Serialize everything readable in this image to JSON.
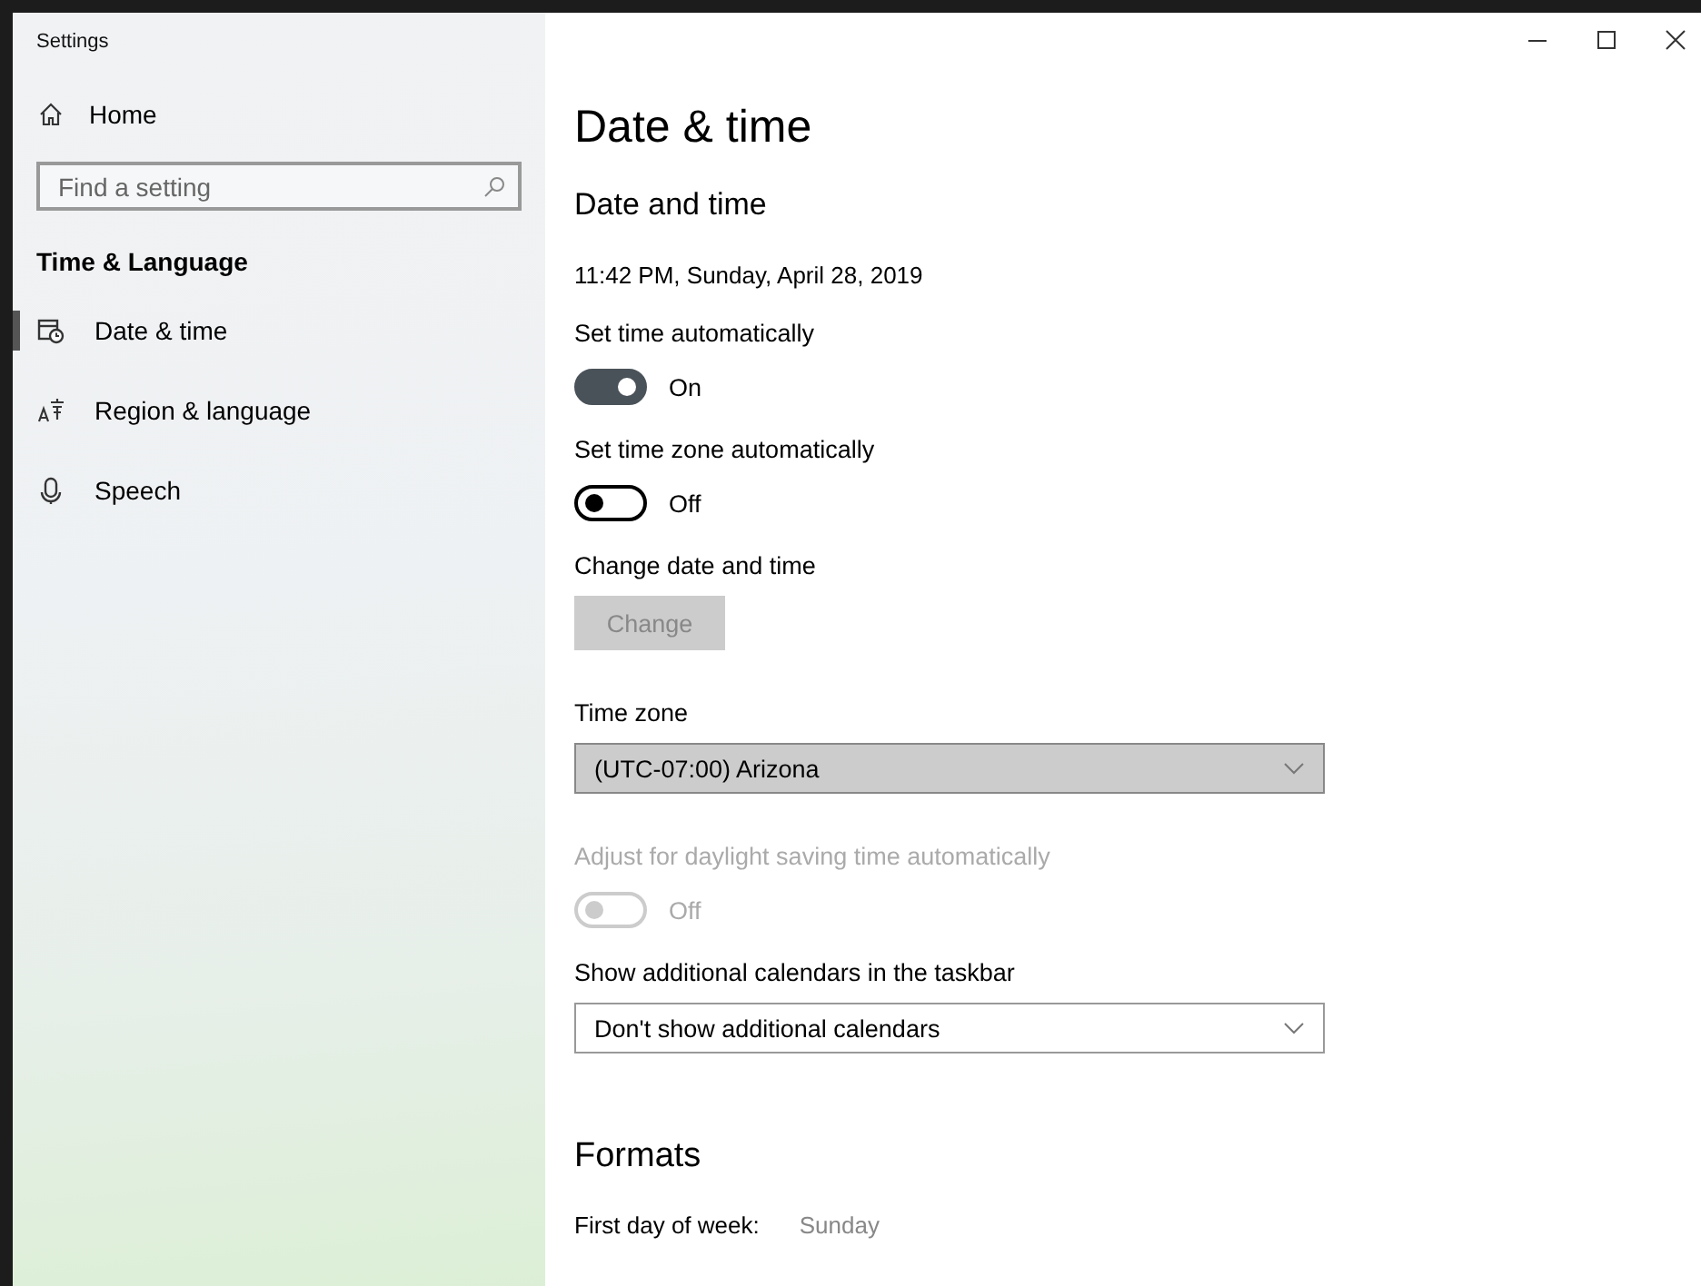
{
  "window": {
    "title": "Settings"
  },
  "sidebar": {
    "home": "Home",
    "search": {
      "placeholder": "Find a setting"
    },
    "section": "Time & Language",
    "items": [
      {
        "label": "Date & time",
        "selected": true
      },
      {
        "label": "Region & language",
        "selected": false
      },
      {
        "label": "Speech",
        "selected": false
      }
    ]
  },
  "page": {
    "title": "Date & time",
    "heading": "Date and time",
    "current": "11:42 PM, Sunday, April 28, 2019",
    "settings": [
      {
        "kind": "toggle",
        "label": "Set time automatically",
        "on": true,
        "disabled": false,
        "state": "On"
      },
      {
        "kind": "toggle",
        "label": "Set time zone automatically",
        "on": false,
        "disabled": false,
        "state": "Off"
      },
      {
        "kind": "button",
        "label": "Change date and time",
        "button": "Change",
        "disabled": true
      },
      {
        "kind": "dropdown",
        "label": "Time zone",
        "value": "(UTC-07:00) Arizona",
        "highlighted": true
      },
      {
        "kind": "toggle",
        "label": "Adjust for daylight saving time automatically",
        "on": false,
        "disabled": true,
        "state": "Off"
      },
      {
        "kind": "dropdown",
        "label": "Show additional calendars in the taskbar",
        "value": "Don't show additional calendars",
        "highlighted": false
      }
    ]
  },
  "formats": {
    "title": "Formats",
    "rows": [
      {
        "label": "First day of week:",
        "value": "Sunday"
      }
    ]
  }
}
